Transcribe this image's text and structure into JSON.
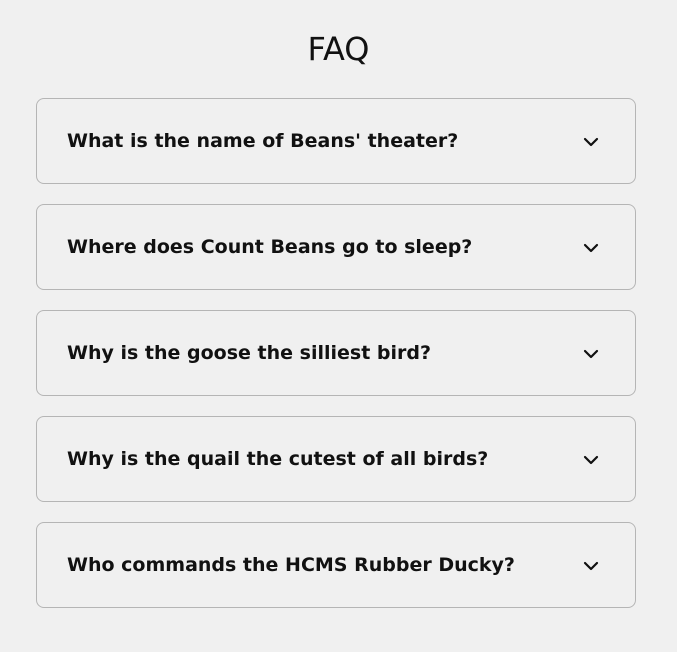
{
  "page": {
    "title": "FAQ"
  },
  "faq": {
    "items": [
      {
        "question": "What is the name of Beans' theater?",
        "icon": "chevron-down-icon"
      },
      {
        "question": "Where does Count Beans go to sleep?",
        "icon": "chevron-down-icon"
      },
      {
        "question": "Why is the goose the silliest bird?",
        "icon": "chevron-down-icon"
      },
      {
        "question": "Why is the quail the cutest of all birds?",
        "icon": "chevron-down-icon"
      },
      {
        "question": "Who commands the HCMS Rubber Ducky?",
        "icon": "chevron-down-icon"
      }
    ]
  }
}
